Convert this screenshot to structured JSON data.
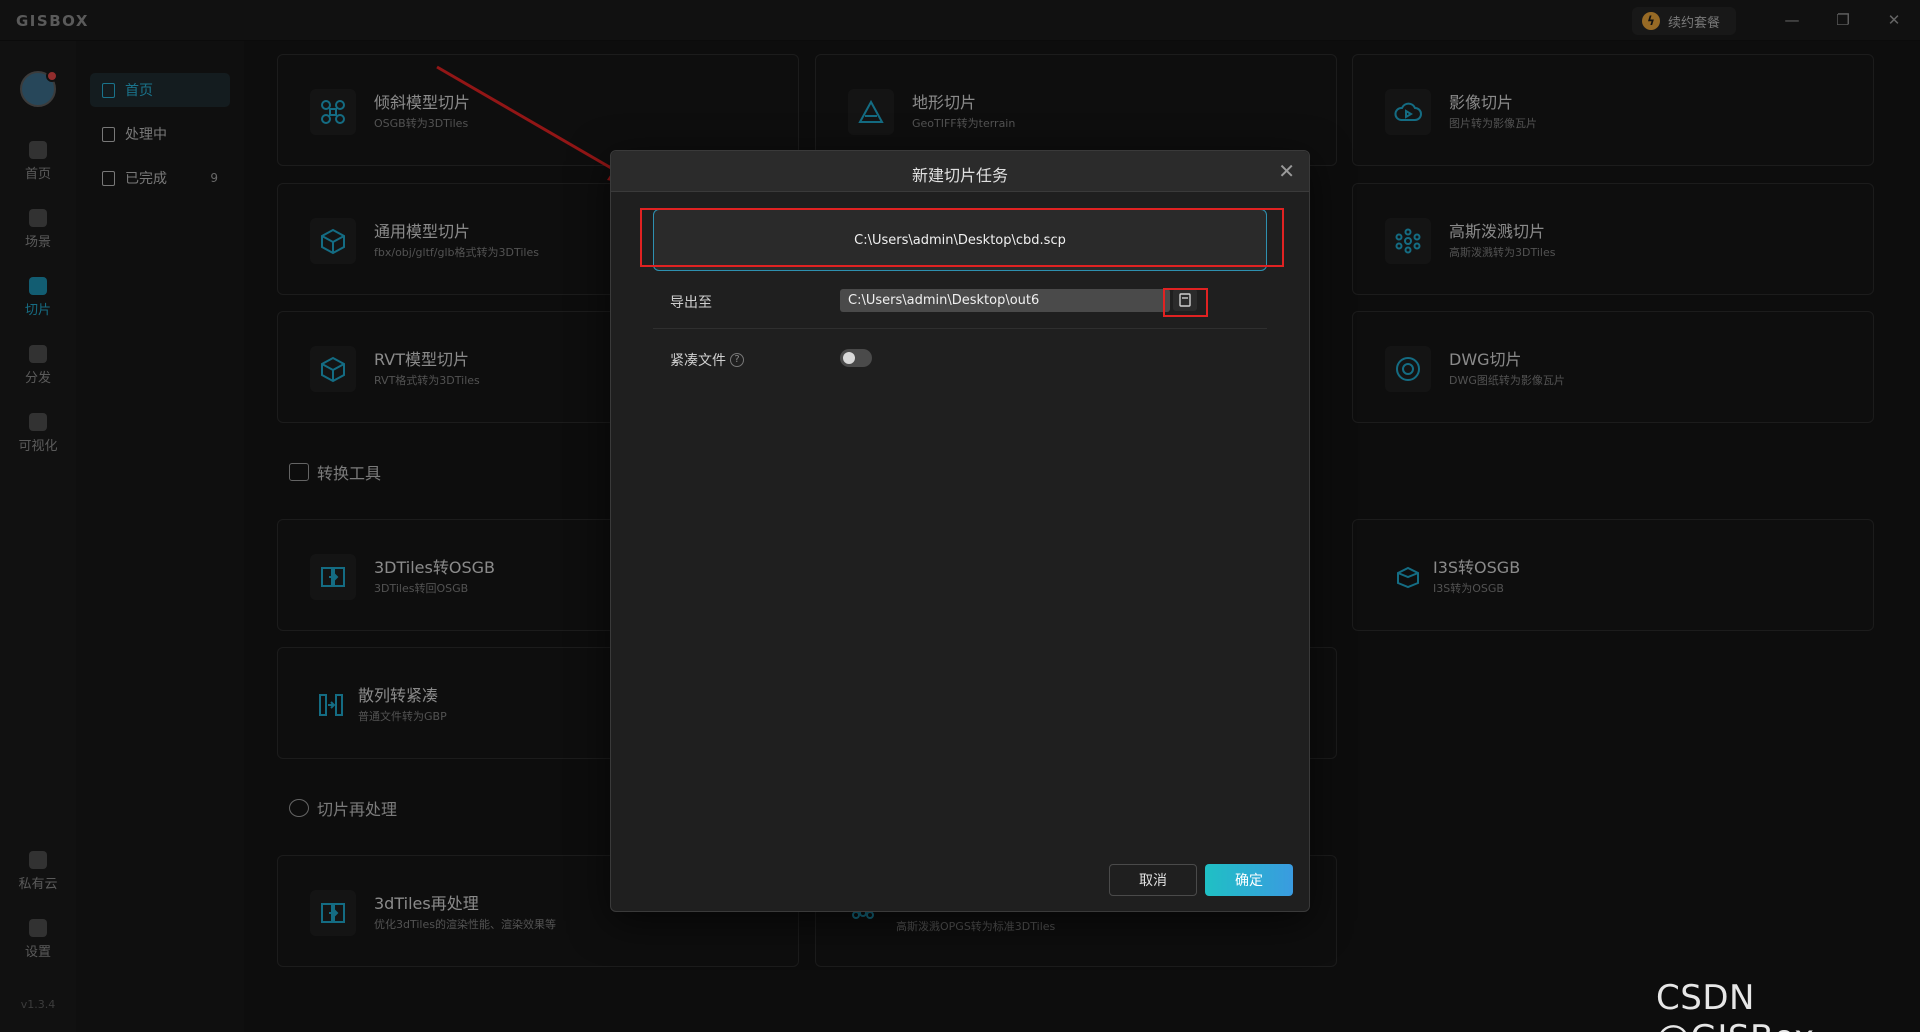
{
  "app": {
    "logo": "GISBOX",
    "subscription_label": "续约套餐",
    "version": "v1.3.4",
    "window_controls": {
      "minimize": "—",
      "restore": "❐",
      "close": "✕"
    }
  },
  "rail": {
    "items": [
      {
        "label": "首页",
        "icon": "home-icon"
      },
      {
        "label": "场景",
        "icon": "cube-icon"
      },
      {
        "label": "切片",
        "icon": "slice-icon"
      },
      {
        "label": "分发",
        "icon": "distribute-icon"
      },
      {
        "label": "可视化",
        "icon": "visual-icon"
      },
      {
        "label": "私有云",
        "icon": "lock-icon"
      },
      {
        "label": "设置",
        "icon": "gear-icon"
      }
    ]
  },
  "subnav": {
    "items": [
      {
        "label": "首页"
      },
      {
        "label": "处理中"
      },
      {
        "label": "已完成",
        "count": "9"
      }
    ]
  },
  "cards": {
    "oblique": {
      "title": "倾斜模型切片",
      "desc": "OSGB转为3DTiles"
    },
    "terrain": {
      "title": "地形切片",
      "desc": "GeoTIFF转为terrain"
    },
    "imagery": {
      "title": "影像切片",
      "desc": "图片转为影像瓦片"
    },
    "generic": {
      "title": "通用模型切片",
      "desc": "fbx/obj/gltf/glb格式转为3DTiles"
    },
    "gaussian": {
      "title": "高斯泼溅切片",
      "desc": "高斯泼溅转为3DTiles"
    },
    "rvt": {
      "title": "RVT模型切片",
      "desc": "RVT格式转为3DTiles"
    },
    "dwg": {
      "title": "DWG切片",
      "desc": "DWG图纸转为影像瓦片"
    },
    "tiles2osgb": {
      "title": "3DTiles转OSGB",
      "desc": "3DTiles转回OSGB"
    },
    "i3s2osgb": {
      "title": "I3S转OSGB",
      "desc": "I3S转为OSGB"
    },
    "scatter": {
      "title": "散列转紧凑",
      "desc": "普通文件转为GBP"
    },
    "reprocess": {
      "title": "3dTiles再处理",
      "desc": "优化3dTiles的渲染性能、渲染效果等"
    },
    "gaussian_partial": {
      "desc": "高斯泼溅OPGS转为标准3DTiles"
    }
  },
  "sections": {
    "convert": "转换工具",
    "reprocess": "切片再处理"
  },
  "dialog": {
    "title": "新建切片任务",
    "source_path": "C:\\Users\\admin\\Desktop\\cbd.scp",
    "export_label": "导出至",
    "export_path": "C:\\Users\\admin\\Desktop\\out6",
    "compact_label": "紧凑文件",
    "help_glyph": "?",
    "cancel_label": "取消",
    "ok_label": "确定",
    "close_glyph": "✕"
  },
  "watermark": "CSDN @GISBox",
  "colors": {
    "accent": "#29b1d6",
    "annotation": "#e02222",
    "ok_gradient_start": "#1fc0c4",
    "ok_gradient_end": "#3a9be0"
  }
}
